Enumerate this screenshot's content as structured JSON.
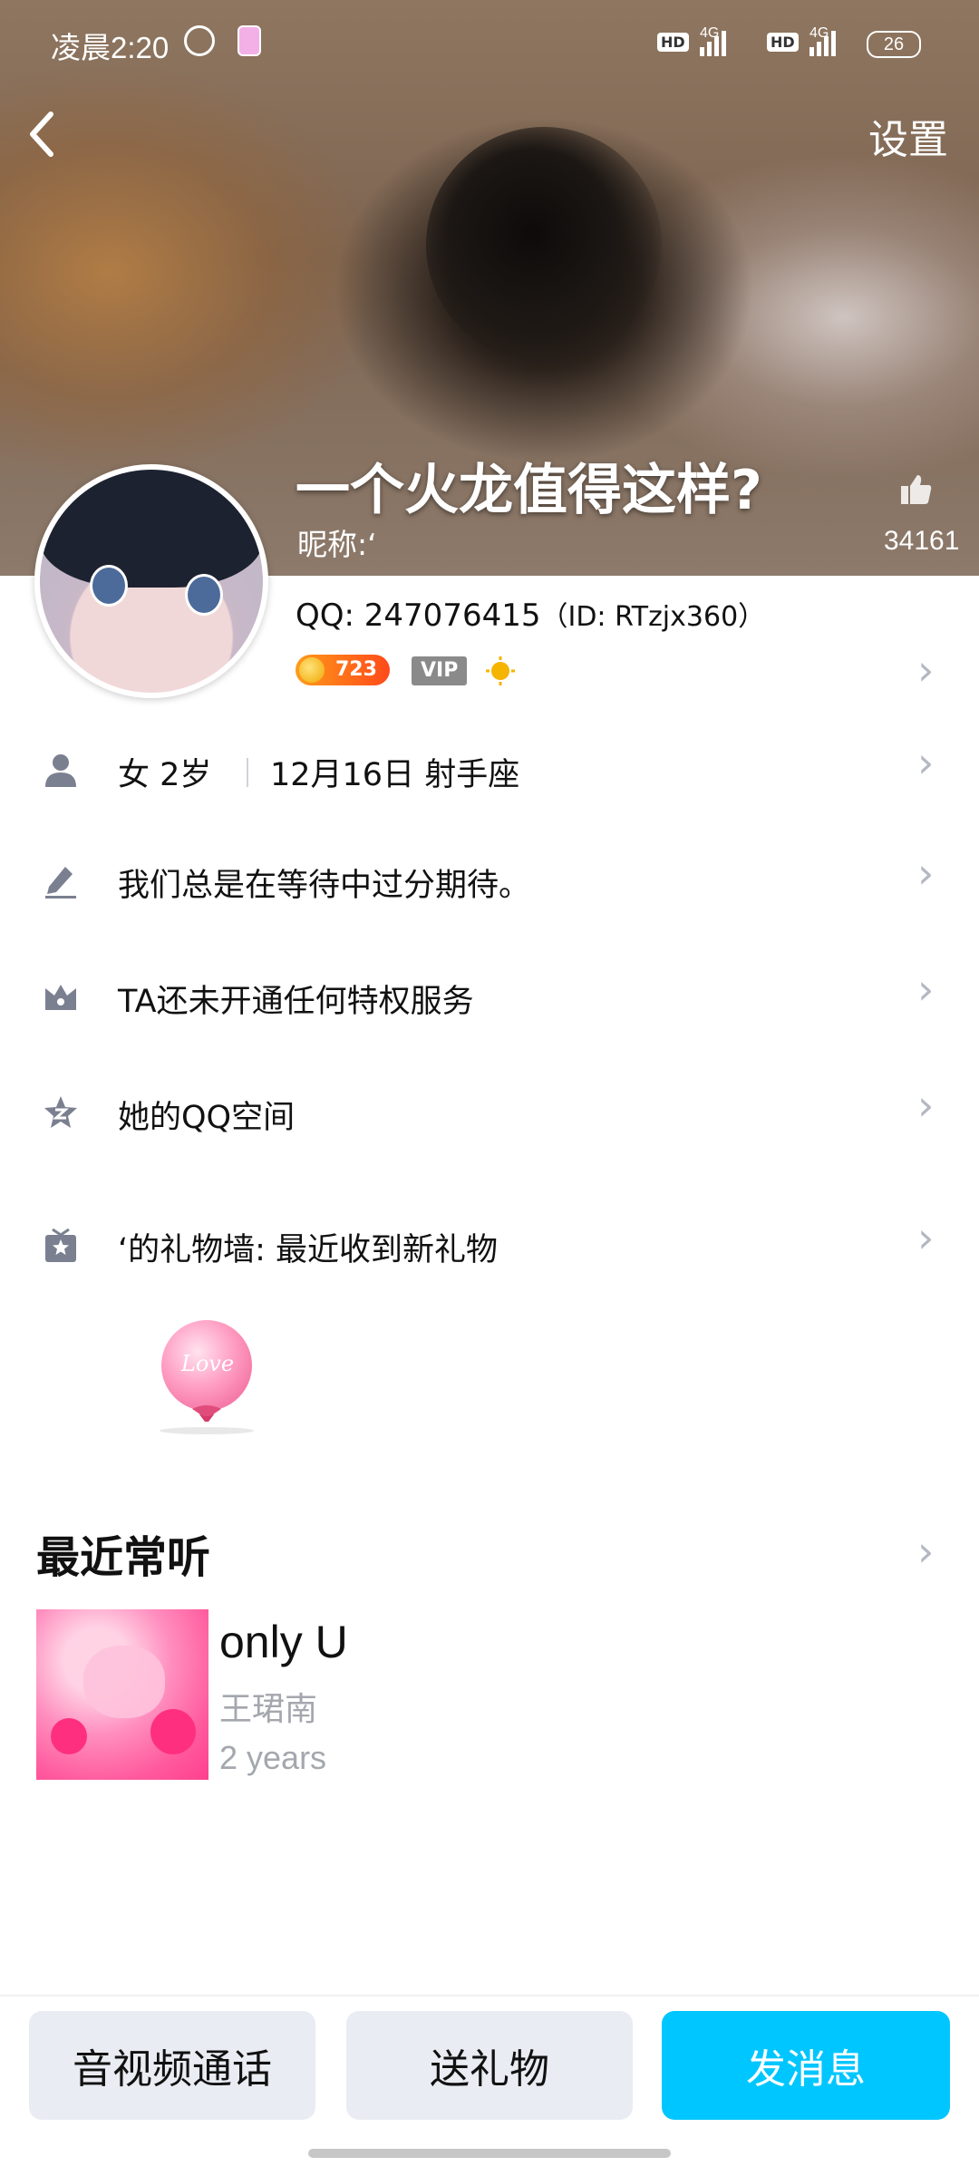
{
  "status_bar": {
    "time": "凌晨2:20",
    "network1": "4G",
    "network2": "4G",
    "hd": "HD",
    "battery": "26"
  },
  "header": {
    "back_icon": "chevron-left-icon",
    "settings_label": "设置"
  },
  "profile": {
    "title": "一个火龙值得这样?",
    "nickname": "昵称:‘",
    "likes": "34161",
    "qq_label": "QQ: 247076415",
    "qq_id": "（ID: RTzjx360）",
    "level": "723",
    "vip": "VIP"
  },
  "rows": [
    {
      "icon": "person-icon",
      "text": "女 2岁",
      "text2": "12月16日 射手座"
    },
    {
      "icon": "pencil-icon",
      "text": "我们总是在等待中过分期待。"
    },
    {
      "icon": "crown-icon",
      "text": "TA还未开通任何特权服务"
    },
    {
      "icon": "qzone-star-icon",
      "text": "她的QQ空间"
    },
    {
      "icon": "gift-icon",
      "text": "‘的礼物墙: 最近收到新礼物"
    }
  ],
  "gift": {
    "balloon_text": "Love"
  },
  "recent": {
    "title": "最近常听",
    "song": "only U",
    "artist": "王珺南",
    "time": "2 years"
  },
  "actions": {
    "call": "音视频通话",
    "gift": "送礼物",
    "message": "发消息"
  },
  "colors": {
    "accent": "#00c6ff",
    "chevron": "#b4b8c2"
  }
}
